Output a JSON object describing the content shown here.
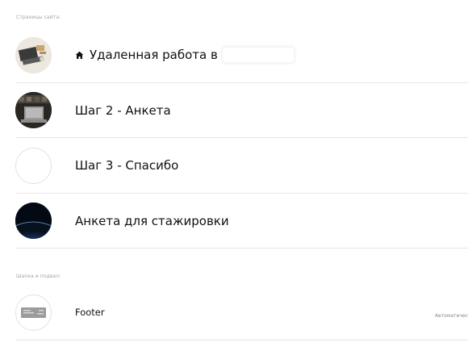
{
  "sections": {
    "pages_label": "Страницы сайта:",
    "header_footer_label": "Шапка и подвал:"
  },
  "pages": [
    {
      "title": "Удаленная работа в",
      "icon": "home-icon",
      "thumb": "laptop-desk-thumbnail"
    },
    {
      "title": "Шаг 2 - Анкета",
      "thumb": "laptop-photo-thumbnail"
    },
    {
      "title": "Шаг 3 - Спасибо",
      "thumb": "empty-thumbnail"
    },
    {
      "title": "Анкета для стажировки",
      "thumb": "earth-space-thumbnail"
    }
  ],
  "header_footer": [
    {
      "title": "Footer",
      "badge": "Автоматичес",
      "thumb": "footer-block-thumbnail"
    }
  ],
  "colors": {
    "divider": "#e5e5e5",
    "label": "#a3a3a3"
  }
}
